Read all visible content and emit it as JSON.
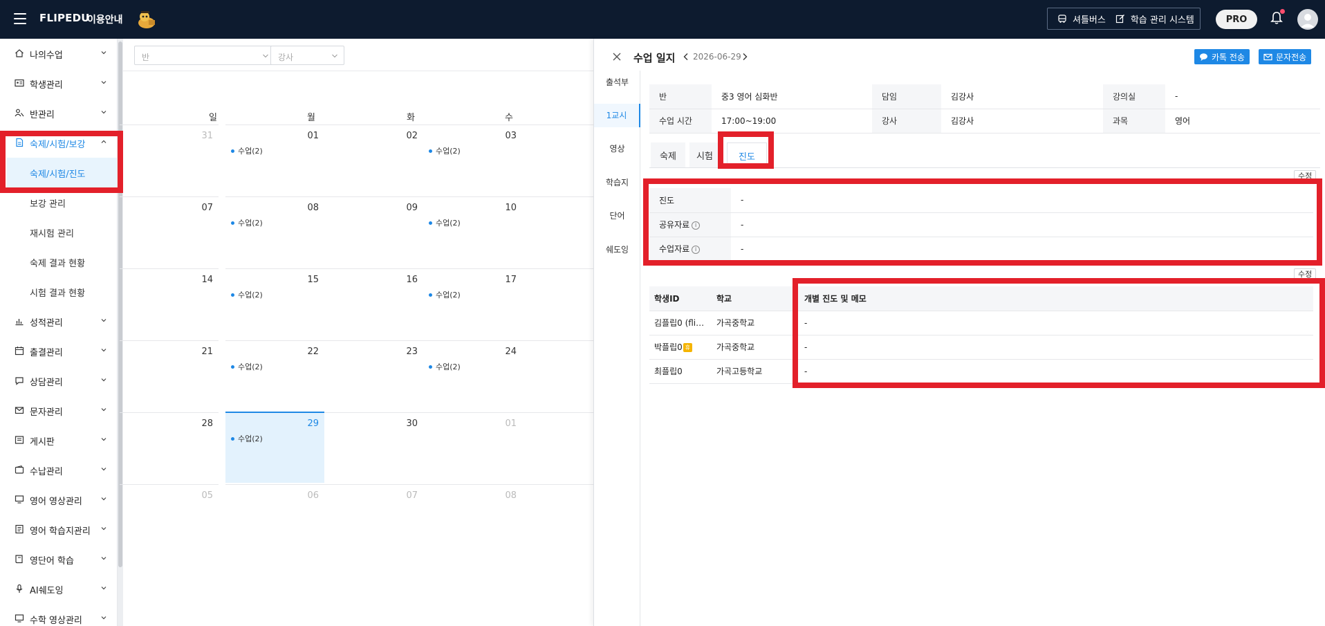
{
  "topbar": {
    "brand": "FLIPEDU",
    "brand_sub": "이용안내",
    "shuttle_label": "셔틀버스",
    "lms_label": "학습 관리 시스템",
    "pro_label": "PRO"
  },
  "sidebar": {
    "menu": [
      {
        "label": "나의수업"
      },
      {
        "label": "학생관리"
      },
      {
        "label": "반관리"
      },
      {
        "label": "숙제/시험/보강"
      },
      {
        "label": "성적관리"
      },
      {
        "label": "출결관리"
      },
      {
        "label": "상담관리"
      },
      {
        "label": "문자관리"
      },
      {
        "label": "게시판"
      },
      {
        "label": "수납관리"
      },
      {
        "label": "영어 영상관리"
      },
      {
        "label": "영어 학습지관리"
      },
      {
        "label": "영단어 학습"
      },
      {
        "label": "AI쉐도잉"
      },
      {
        "label": "수학 영상관리"
      }
    ],
    "submenu": [
      {
        "label": "숙제/시험/진도"
      },
      {
        "label": "보강 관리"
      },
      {
        "label": "재시험 관리"
      },
      {
        "label": "숙제 결과 현황"
      },
      {
        "label": "시험 결과 현황"
      }
    ]
  },
  "calendar": {
    "filter_class": "반",
    "filter_teacher": "강사",
    "weekdays": [
      "일",
      "월",
      "화",
      "수"
    ],
    "event_label": "수업(2)",
    "weeks": [
      [
        "31",
        "01",
        "02",
        "03"
      ],
      [
        "07",
        "08",
        "09",
        "10"
      ],
      [
        "14",
        "15",
        "16",
        "17"
      ],
      [
        "21",
        "22",
        "23",
        "24"
      ],
      [
        "28",
        "29",
        "30",
        "01"
      ],
      [
        "05",
        "06",
        "07",
        "08"
      ]
    ]
  },
  "panel": {
    "title": "수업 일지",
    "date": "2026-06-29",
    "kakao_button": "카톡 전송",
    "sms_button": "문자전송",
    "side_tabs": [
      "출석부",
      "1교시",
      "영상",
      "학습지",
      "단어",
      "쉐도잉"
    ],
    "info": {
      "class_h": "반",
      "class_v": "중3 영어 심화반",
      "homeroom_h": "담임",
      "homeroom_v": "김강사",
      "room_h": "강의실",
      "room_v": "-",
      "time_h": "수업 시간",
      "time_v": "17:00~19:00",
      "teacher_h": "강사",
      "teacher_v": "김강사",
      "subject_h": "과목",
      "subject_v": "영어"
    },
    "sub_tabs": [
      "숙제",
      "시험",
      "진도"
    ],
    "edit_label": "수정",
    "progress": {
      "progress_h": "진도",
      "progress_v": "-",
      "shared_h": "공유자료",
      "shared_v": "-",
      "class_h": "수업자료",
      "class_v": "-"
    },
    "students": {
      "headers": [
        "학생ID",
        "학교",
        "개별 진도 및 메모"
      ],
      "rows": [
        {
          "id": "김플립0 (fli…",
          "school": "가곡중학교",
          "memo": "-"
        },
        {
          "id": "박플립0",
          "school": "가곡중학교",
          "memo": "-"
        },
        {
          "id": "최플립0",
          "school": "가곡고등학교",
          "memo": "-"
        }
      ],
      "badge": "휴"
    }
  }
}
